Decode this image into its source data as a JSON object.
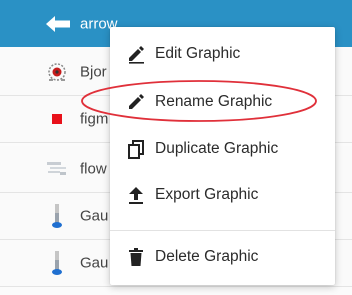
{
  "list": {
    "rows": [
      {
        "label": "arrow",
        "icon": "arrow-left-icon",
        "selected": true
      },
      {
        "label": "Bjor",
        "icon": "gear-thumbnail-icon",
        "selected": false
      },
      {
        "label": "figm",
        "icon": "red-square-icon",
        "selected": false
      },
      {
        "label": "flow",
        "icon": "flow-thumbnail-icon",
        "selected": false
      },
      {
        "label": "Gau",
        "icon": "gauge-thumbnail-icon",
        "selected": false
      },
      {
        "label": "Gau",
        "icon": "gauge-thumbnail-icon",
        "selected": false
      }
    ]
  },
  "context_menu": {
    "items": [
      {
        "label": "Edit Graphic",
        "icon": "edit-icon"
      },
      {
        "label": "Rename Graphic",
        "icon": "pencil-icon"
      },
      {
        "label": "Duplicate Graphic",
        "icon": "duplicate-icon"
      },
      {
        "label": "Export Graphic",
        "icon": "upload-icon"
      },
      {
        "label": "Delete Graphic",
        "icon": "trash-icon"
      }
    ]
  },
  "colors": {
    "selected_row": "#2a91c5",
    "highlight_ellipse": "#e0303a"
  }
}
